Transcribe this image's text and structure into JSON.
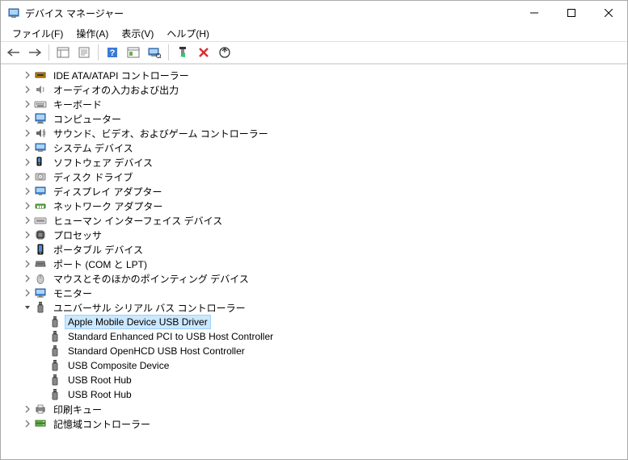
{
  "window": {
    "title": "デバイス マネージャー"
  },
  "menu": {
    "file": "ファイル(F)",
    "action": "操作(A)",
    "view": "表示(V)",
    "help": "ヘルプ(H)"
  },
  "tree": [
    {
      "label": "IDE ATA/ATAPI コントローラー",
      "icon": "ide",
      "expanded": false,
      "level": 1
    },
    {
      "label": "オーディオの入力および出力",
      "icon": "audio",
      "expanded": false,
      "level": 1
    },
    {
      "label": "キーボード",
      "icon": "keyboard",
      "expanded": false,
      "level": 1
    },
    {
      "label": "コンピューター",
      "icon": "computer",
      "expanded": false,
      "level": 1
    },
    {
      "label": "サウンド、ビデオ、およびゲーム コントローラー",
      "icon": "sound",
      "expanded": false,
      "level": 1
    },
    {
      "label": "システム デバイス",
      "icon": "system",
      "expanded": false,
      "level": 1
    },
    {
      "label": "ソフトウェア デバイス",
      "icon": "software",
      "expanded": false,
      "level": 1
    },
    {
      "label": "ディスク ドライブ",
      "icon": "disk",
      "expanded": false,
      "level": 1
    },
    {
      "label": "ディスプレイ アダプター",
      "icon": "display",
      "expanded": false,
      "level": 1
    },
    {
      "label": "ネットワーク アダプター",
      "icon": "network",
      "expanded": false,
      "level": 1
    },
    {
      "label": "ヒューマン インターフェイス デバイス",
      "icon": "hid",
      "expanded": false,
      "level": 1
    },
    {
      "label": "プロセッサ",
      "icon": "cpu",
      "expanded": false,
      "level": 1
    },
    {
      "label": "ポータブル デバイス",
      "icon": "portable",
      "expanded": false,
      "level": 1
    },
    {
      "label": "ポート (COM と LPT)",
      "icon": "port",
      "expanded": false,
      "level": 1
    },
    {
      "label": "マウスとそのほかのポインティング デバイス",
      "icon": "mouse",
      "expanded": false,
      "level": 1
    },
    {
      "label": "モニター",
      "icon": "monitor",
      "expanded": false,
      "level": 1
    },
    {
      "label": "ユニバーサル シリアル バス コントローラー",
      "icon": "usb",
      "expanded": true,
      "level": 1,
      "children": [
        {
          "label": "Apple Mobile Device USB Driver",
          "icon": "usb",
          "level": 2,
          "selected": true
        },
        {
          "label": "Standard Enhanced PCI to USB Host Controller",
          "icon": "usb",
          "level": 2
        },
        {
          "label": "Standard OpenHCD USB Host Controller",
          "icon": "usb",
          "level": 2
        },
        {
          "label": "USB Composite Device",
          "icon": "usb",
          "level": 2
        },
        {
          "label": "USB Root Hub",
          "icon": "usb",
          "level": 2
        },
        {
          "label": "USB Root Hub",
          "icon": "usb",
          "level": 2
        }
      ]
    },
    {
      "label": "印刷キュー",
      "icon": "printer",
      "expanded": false,
      "level": 1
    },
    {
      "label": "記憶域コントローラー",
      "icon": "storage",
      "expanded": false,
      "level": 1
    }
  ]
}
